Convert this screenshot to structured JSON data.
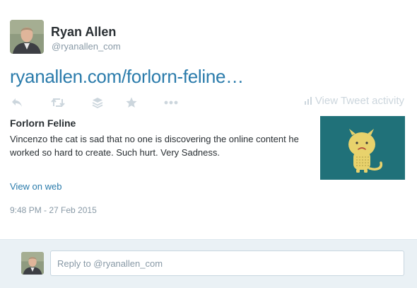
{
  "user": {
    "display_name": "Ryan Allen",
    "handle": "@ryanallen_com"
  },
  "tweet": {
    "link_text": "ryanallen.com/forlorn-feline…",
    "timestamp": "9:48 PM - 27 Feb 2015"
  },
  "actions": {
    "icons": [
      "reply-icon",
      "retweet-icon",
      "stack-icon",
      "favorite-icon",
      "more-icon"
    ],
    "view_activity_label": "View Tweet activity"
  },
  "card": {
    "title": "Forlorn Feline",
    "description": "Vincenzo the cat is sad that no one is discovering the online content he worked so hard to create. Such hurt. Very Sadness.",
    "view_on_web": "View on web"
  },
  "reply": {
    "placeholder": "Reply to @ryanallen_com"
  },
  "colors": {
    "link": "#2a7bab",
    "muted": "#8899a6",
    "icon": "#ccd6dd",
    "card_background": "#207179",
    "cat": "#e8d26c",
    "reply_bar": "#eaf1f5"
  }
}
